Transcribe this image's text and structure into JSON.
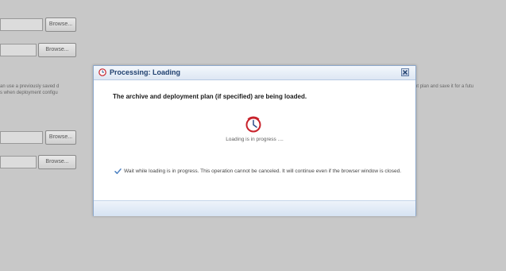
{
  "background": {
    "browse_buttons": [
      "Browse...",
      "Browse...",
      "Browse...",
      "Browse..."
    ],
    "left_text": [
      "an use a previously saved d",
      "s when deployment configu"
    ],
    "right_text": "nt plan and save it for a futu"
  },
  "dialog": {
    "title": "Processing: Loading",
    "message": "The archive and deployment plan (if specified) are being loaded.",
    "status": "Loading is in progress ....",
    "info": "Wait while loading is in progress. This operation cannot be canceled. It will continue even if the browser window is closed.",
    "icons": {
      "title": "clock-icon",
      "close": "close-icon",
      "status": "clock-icon",
      "info": "checkmark-icon"
    }
  },
  "colors": {
    "overlay": "#c8c8c8",
    "dialog_border": "#8ea9cc",
    "title_text": "#1f3f6e",
    "clock_red": "#c8232c"
  }
}
